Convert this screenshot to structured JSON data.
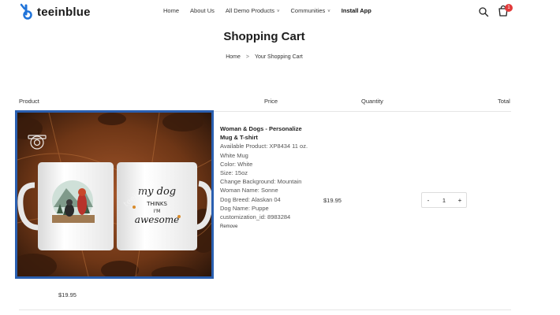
{
  "header": {
    "logo_text": "teeinblue",
    "nav": [
      {
        "label": "Home",
        "caret": ""
      },
      {
        "label": "About Us",
        "caret": ""
      },
      {
        "label": "All Demo Products",
        "caret": "˅"
      },
      {
        "label": "Communities",
        "caret": "˅"
      },
      {
        "label": "Install App",
        "caret": ""
      }
    ],
    "cart_count": "1",
    "colors": {
      "logo_blue": "#1f73d9",
      "badge": "#e23b3b"
    }
  },
  "page": {
    "title": "Shopping Cart",
    "breadcrumb": {
      "home": "Home",
      "separator": ">",
      "current": "Your Shopping Cart"
    }
  },
  "table": {
    "headers": {
      "product": "Product",
      "price": "Price",
      "quantity": "Quantity",
      "total": "Total"
    }
  },
  "item": {
    "image_icon": "mug-product-image",
    "mug_text": "my dog THINKS I'M awesome",
    "name": "Woman & Dogs - Personalize Mug & T-shirt",
    "options": [
      "Available Product: XP8434 11 oz. White Mug",
      "Color: White",
      "Size: 15oz",
      "Change Background: Mountain",
      "Woman Name: Sonne",
      "Dog Breed: Alaskan 04",
      "Dog Name: Puppe",
      "customization_id: 8983284"
    ],
    "remove_label": "Remove",
    "price": "$19.95",
    "quantity": "1",
    "minus": "-",
    "plus": "+",
    "line_price": "$19.95",
    "selection_color": "#2a5fb0"
  }
}
